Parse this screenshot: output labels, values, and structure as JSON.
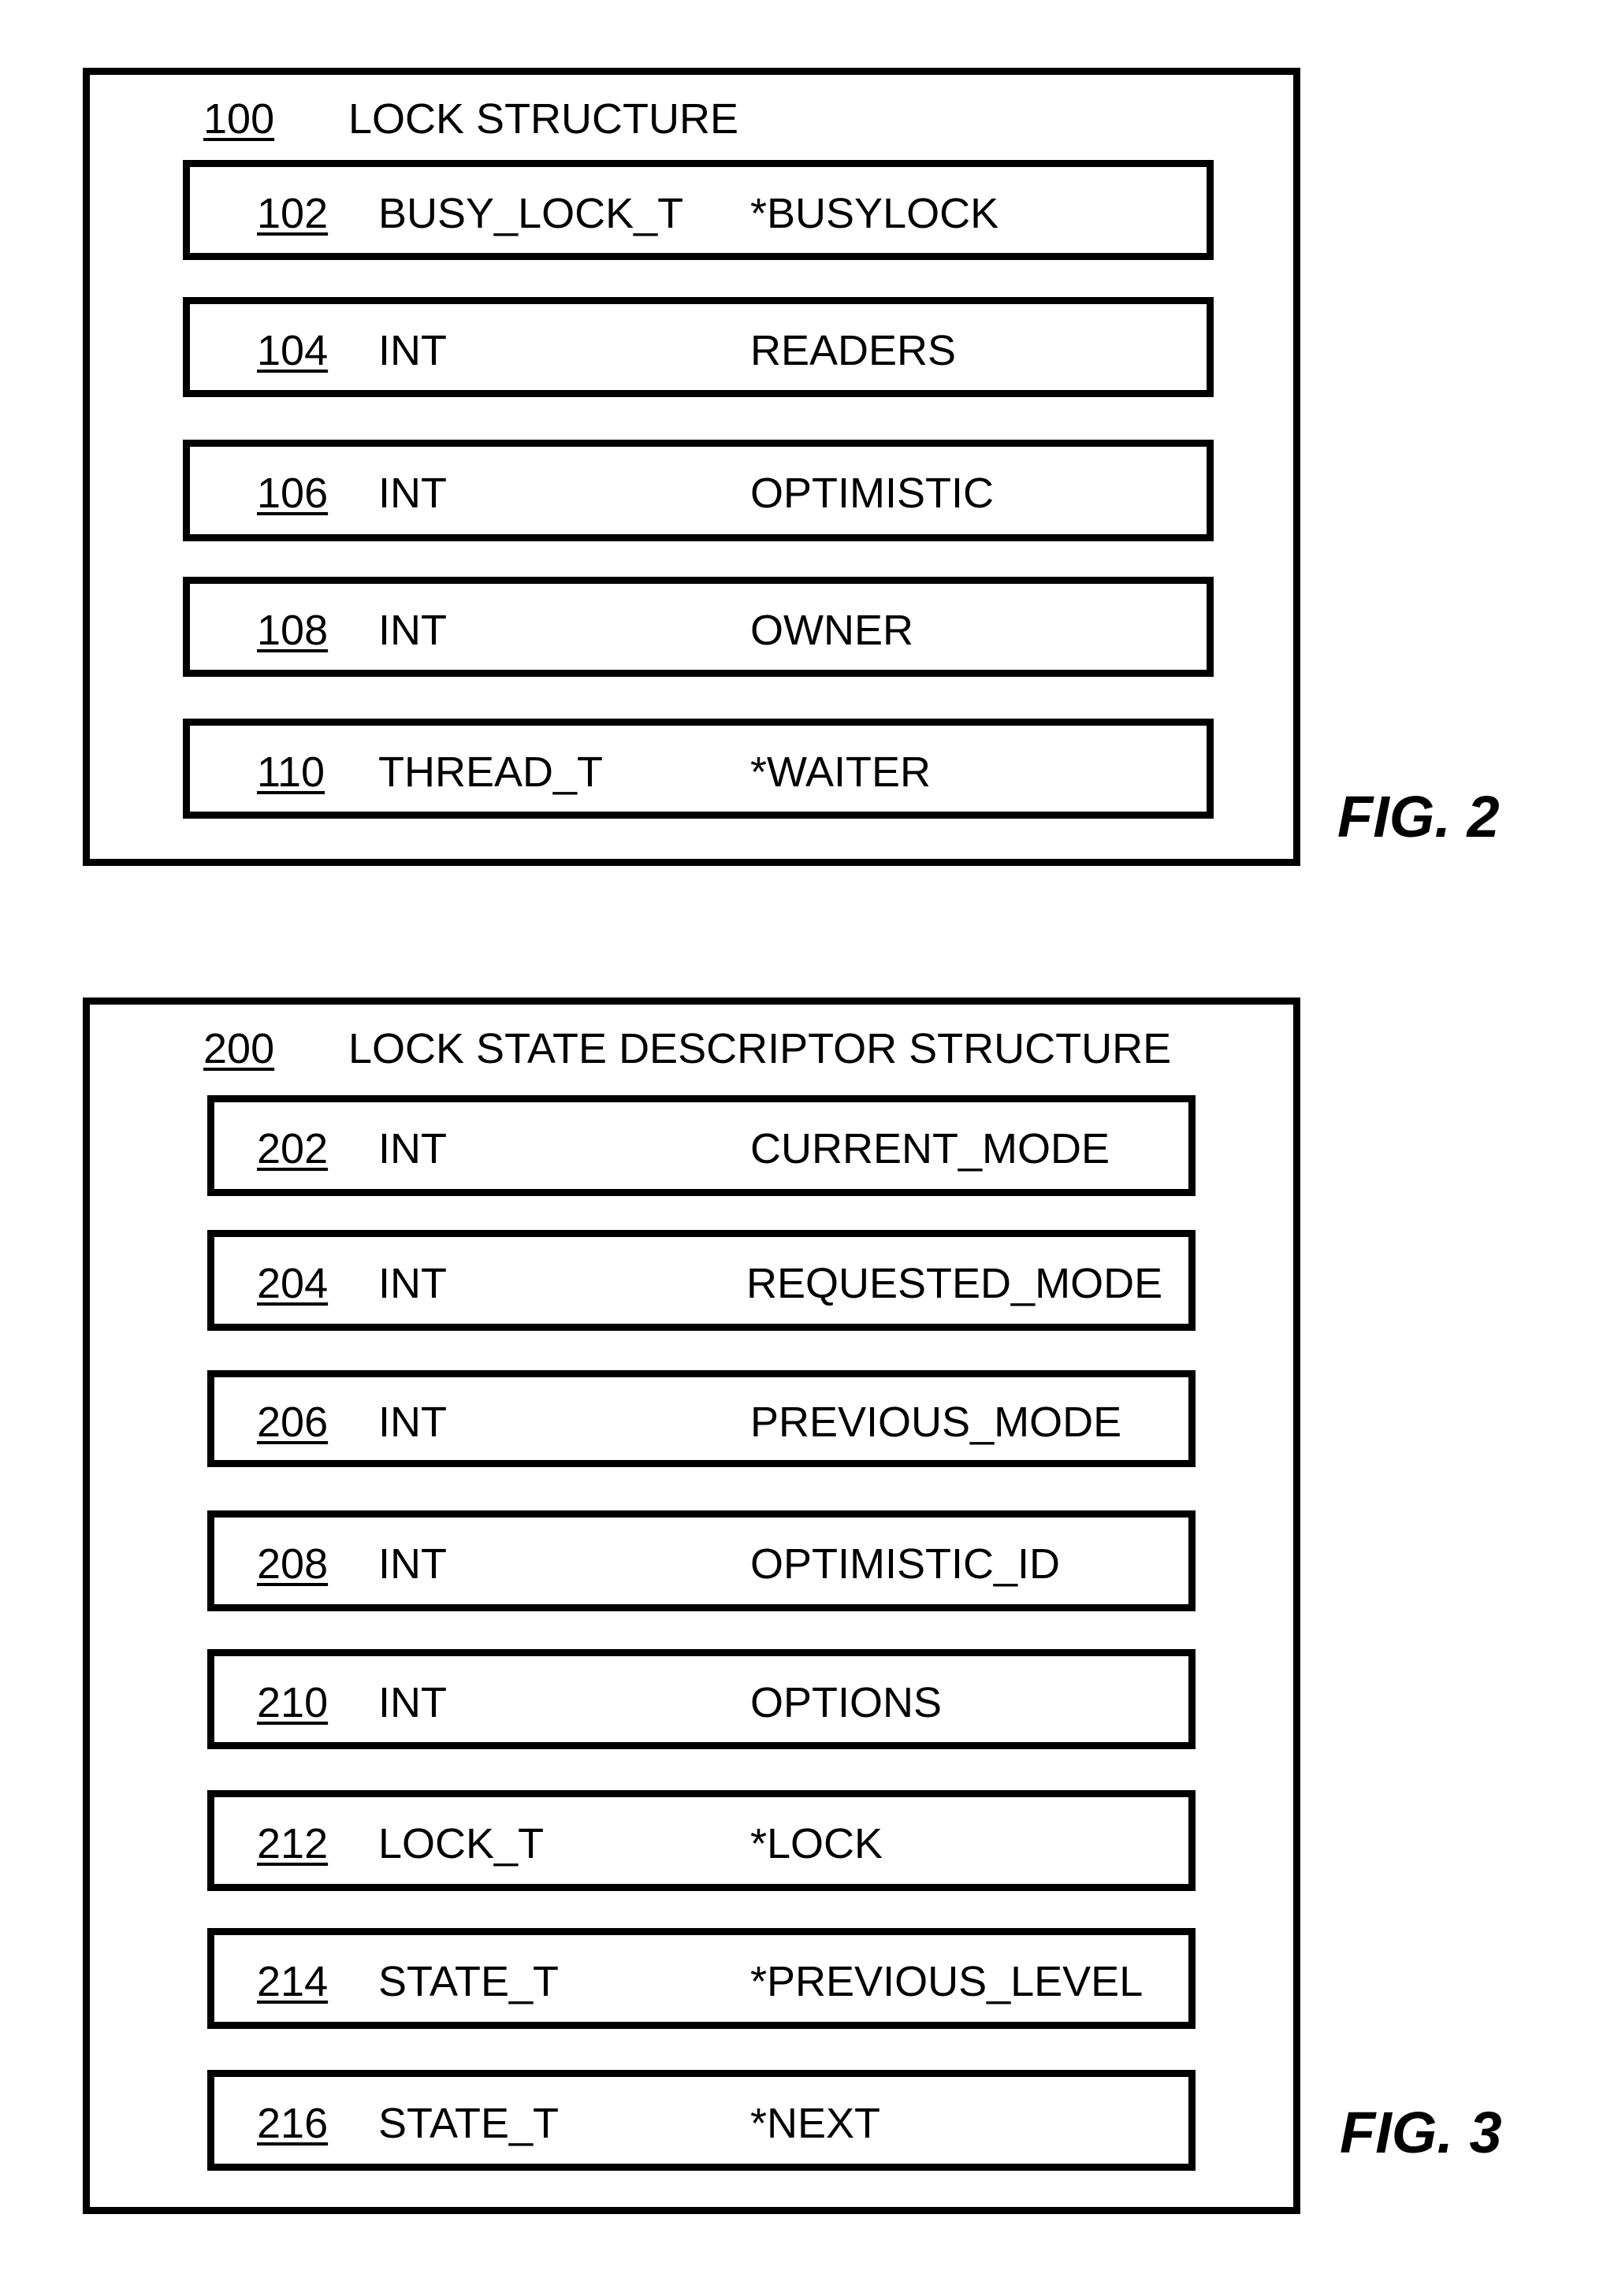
{
  "figures": [
    {
      "label": "FIG. 2",
      "ref": "100",
      "title": "LOCK STRUCTURE",
      "fields": [
        {
          "ref": "102",
          "type": "BUSY_LOCK_T",
          "name": "*BUSYLOCK"
        },
        {
          "ref": "104",
          "type": "INT",
          "name": "READERS"
        },
        {
          "ref": "106",
          "type": "INT",
          "name": "OPTIMISTIC"
        },
        {
          "ref": "108",
          "type": "INT",
          "name": "OWNER"
        },
        {
          "ref": "110",
          "type": "THREAD_T",
          "name": "*WAITER"
        }
      ]
    },
    {
      "label": "FIG. 3",
      "ref": "200",
      "title": "LOCK STATE DESCRIPTOR STRUCTURE",
      "fields": [
        {
          "ref": "202",
          "type": "INT",
          "name": "CURRENT_MODE"
        },
        {
          "ref": "204",
          "type": "INT",
          "name": "REQUESTED_MODE"
        },
        {
          "ref": "206",
          "type": "INT",
          "name": "PREVIOUS_MODE"
        },
        {
          "ref": "208",
          "type": "INT",
          "name": "OPTIMISTIC_ID"
        },
        {
          "ref": "210",
          "type": "INT",
          "name": "OPTIONS"
        },
        {
          "ref": "212",
          "type": "LOCK_T",
          "name": "*LOCK"
        },
        {
          "ref": "214",
          "type": "STATE_T",
          "name": "*PREVIOUS_LEVEL"
        },
        {
          "ref": "216",
          "type": "STATE_T",
          "name": "*NEXT"
        }
      ]
    }
  ]
}
